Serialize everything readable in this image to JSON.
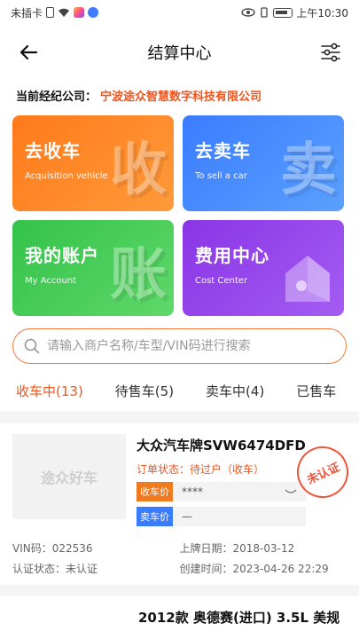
{
  "statusbar": {
    "carrier": "未插卡",
    "time": "上午10:30"
  },
  "nav": {
    "title": "结算中心",
    "back_icon": "arrow-left-icon",
    "filter_icon": "sliders-icon"
  },
  "broker": {
    "label": "当前经纪公司：",
    "company": "宁波途众智慧数字科技有限公司"
  },
  "cards": [
    {
      "title": "去收车",
      "subtitle": "Acquisition vehicle",
      "glyph": "收",
      "color": "#ff7a1a"
    },
    {
      "title": "去卖车",
      "subtitle": "To sell a car",
      "glyph": "卖",
      "color": "#3a7cff"
    },
    {
      "title": "我的账户",
      "subtitle": "My Account",
      "glyph": "账",
      "color": "#34c24a"
    },
    {
      "title": "费用中心",
      "subtitle": "Cost Center",
      "glyph": "",
      "color": "#8a35e6"
    }
  ],
  "search": {
    "placeholder": "请输入商户名称/车型/VIN码进行搜索"
  },
  "tabs": [
    {
      "label": "收车中(13)"
    },
    {
      "label": "待售车(5)"
    },
    {
      "label": "卖车中(4)"
    },
    {
      "label": "已售车"
    }
  ],
  "order": {
    "thumb_text": "途众好车",
    "car_name": "大众汽车牌SVW6474DFD",
    "status": "订单状态：待过户（收车）",
    "recv_label": "收车价",
    "recv_value": "****",
    "sell_label": "卖车价",
    "sell_value": "—",
    "stamp": "未认证",
    "vin": "VIN码：022536",
    "reg_date": "上牌日期：2018-03-12",
    "cert_status": "认证状态：未认证",
    "created": "创建时间：2023-04-26 22:29"
  },
  "next_order": {
    "car_name": "2012款 奥德赛(进口) 3.5L 美规"
  },
  "colors": {
    "accent": "#f2541b",
    "search_border": "#f07a3e"
  }
}
